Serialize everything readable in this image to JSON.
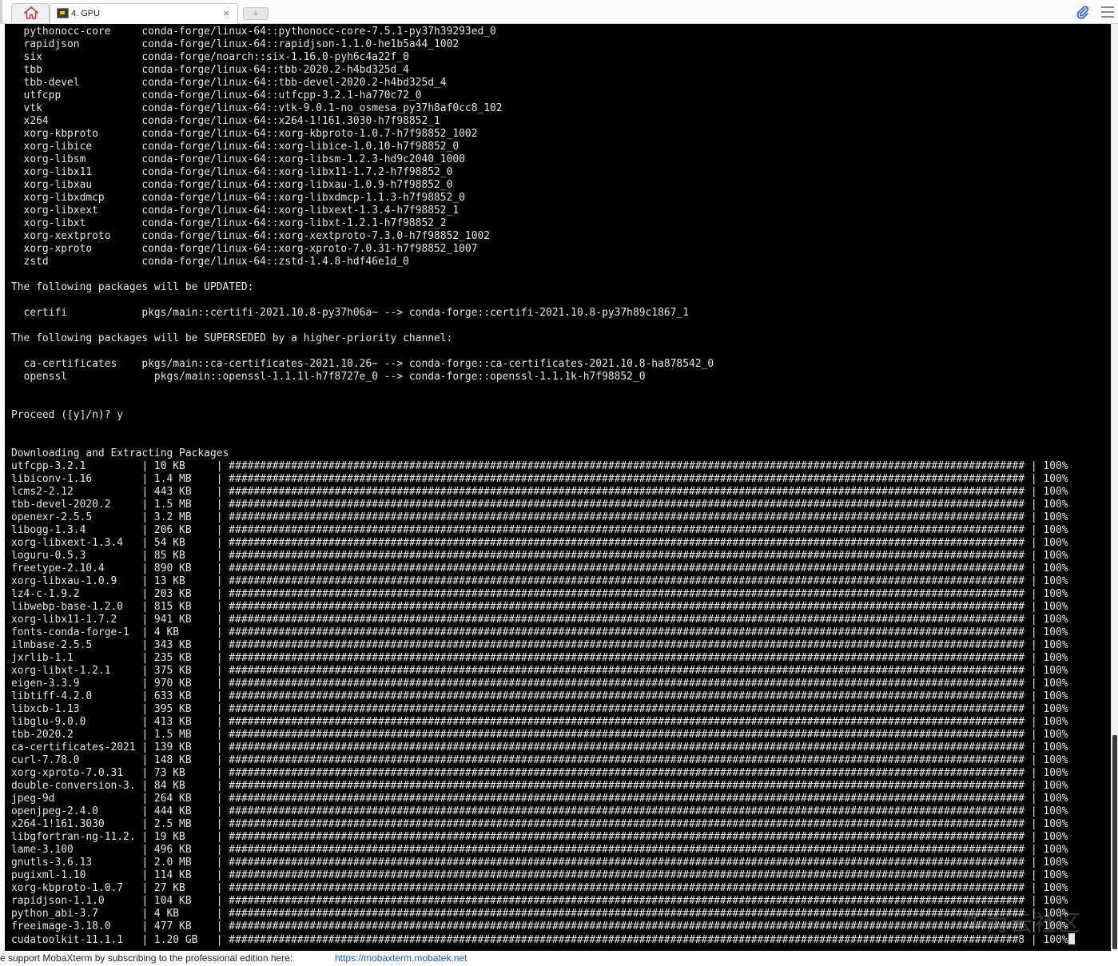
{
  "tabs": {
    "home_icon": "home-icon",
    "active_tab_label": "4. GPU",
    "close_glyph": "×",
    "new_tab_glyph": "+"
  },
  "toolbar": {
    "attach_icon": "paperclip-icon",
    "menu_icon": "hamburger-menu-icon"
  },
  "terminal": {
    "installed_packages": [
      {
        "name": "pythonocc-core",
        "spec": "conda-forge/linux-64::pythonocc-core-7.5.1-py37h39293ed_0"
      },
      {
        "name": "rapidjson",
        "spec": "conda-forge/linux-64::rapidjson-1.1.0-he1b5a44_1002"
      },
      {
        "name": "six",
        "spec": "conda-forge/noarch::six-1.16.0-pyh6c4a22f_0"
      },
      {
        "name": "tbb",
        "spec": "conda-forge/linux-64::tbb-2020.2-h4bd325d_4"
      },
      {
        "name": "tbb-devel",
        "spec": "conda-forge/linux-64::tbb-devel-2020.2-h4bd325d_4"
      },
      {
        "name": "utfcpp",
        "spec": "conda-forge/linux-64::utfcpp-3.2.1-ha770c72_0"
      },
      {
        "name": "vtk",
        "spec": "conda-forge/linux-64::vtk-9.0.1-no_osmesa_py37h8af0cc8_102"
      },
      {
        "name": "x264",
        "spec": "conda-forge/linux-64::x264-1!161.3030-h7f98852_1"
      },
      {
        "name": "xorg-kbproto",
        "spec": "conda-forge/linux-64::xorg-kbproto-1.0.7-h7f98852_1002"
      },
      {
        "name": "xorg-libice",
        "spec": "conda-forge/linux-64::xorg-libice-1.0.10-h7f98852_0"
      },
      {
        "name": "xorg-libsm",
        "spec": "conda-forge/linux-64::xorg-libsm-1.2.3-hd9c2040_1000"
      },
      {
        "name": "xorg-libx11",
        "spec": "conda-forge/linux-64::xorg-libx11-1.7.2-h7f98852_0"
      },
      {
        "name": "xorg-libxau",
        "spec": "conda-forge/linux-64::xorg-libxau-1.0.9-h7f98852_0"
      },
      {
        "name": "xorg-libxdmcp",
        "spec": "conda-forge/linux-64::xorg-libxdmcp-1.1.3-h7f98852_0"
      },
      {
        "name": "xorg-libxext",
        "spec": "conda-forge/linux-64::xorg-libxext-1.3.4-h7f98852_1"
      },
      {
        "name": "xorg-libxt",
        "spec": "conda-forge/linux-64::xorg-libxt-1.2.1-h7f98852_2"
      },
      {
        "name": "xorg-xextproto",
        "spec": "conda-forge/linux-64::xorg-xextproto-7.3.0-h7f98852_1002"
      },
      {
        "name": "xorg-xproto",
        "spec": "conda-forge/linux-64::xorg-xproto-7.0.31-h7f98852_1007"
      },
      {
        "name": "zstd",
        "spec": "conda-forge/linux-64::zstd-1.4.8-hdf46e1d_0"
      }
    ],
    "updated_heading": "The following packages will be UPDATED:",
    "updated_packages": [
      {
        "name": "certifi",
        "spec": "pkgs/main::certifi-2021.10.8-py37h06a~ --> conda-forge::certifi-2021.10.8-py37h89c1867_1"
      }
    ],
    "superseded_heading": "The following packages will be SUPERSEDED by a higher-priority channel:",
    "superseded_packages": [
      {
        "name": "ca-certificates",
        "spec": "pkgs/main::ca-certificates-2021.10.26~ --> conda-forge::ca-certificates-2021.10.8-ha878542_0"
      },
      {
        "name": "openssl",
        "spec": "  pkgs/main::openssl-1.1.1l-h7f8727e_0 --> conda-forge::openssl-1.1.1k-h7f98852_0"
      }
    ],
    "proceed_prompt": "Proceed ([y]/n)? y",
    "download_heading": "Downloading and Extracting Packages",
    "downloads": [
      {
        "pkg": "utfcpp-3.2.1",
        "size": "10 KB",
        "pct": "100%"
      },
      {
        "pkg": "libiconv-1.16",
        "size": "1.4 MB",
        "pct": "100%"
      },
      {
        "pkg": "lcms2-2.12",
        "size": "443 KB",
        "pct": "100%"
      },
      {
        "pkg": "tbb-devel-2020.2",
        "size": "1.5 MB",
        "pct": "100%"
      },
      {
        "pkg": "openexr-2.5.5",
        "size": "3.2 MB",
        "pct": "100%"
      },
      {
        "pkg": "libogg-1.3.4",
        "size": "206 KB",
        "pct": "100%"
      },
      {
        "pkg": "xorg-libxext-1.3.4",
        "size": "54 KB",
        "pct": "100%"
      },
      {
        "pkg": "loguru-0.5.3",
        "size": "85 KB",
        "pct": "100%"
      },
      {
        "pkg": "freetype-2.10.4",
        "size": "890 KB",
        "pct": "100%"
      },
      {
        "pkg": "xorg-libxau-1.0.9",
        "size": "13 KB",
        "pct": "100%"
      },
      {
        "pkg": "lz4-c-1.9.2",
        "size": "203 KB",
        "pct": "100%"
      },
      {
        "pkg": "libwebp-base-1.2.0",
        "size": "815 KB",
        "pct": "100%"
      },
      {
        "pkg": "xorg-libx11-1.7.2",
        "size": "941 KB",
        "pct": "100%"
      },
      {
        "pkg": "fonts-conda-forge-1",
        "size": "4 KB",
        "pct": "100%"
      },
      {
        "pkg": "ilmbase-2.5.5",
        "size": "343 KB",
        "pct": "100%"
      },
      {
        "pkg": "jxrlib-1.1",
        "size": "235 KB",
        "pct": "100%"
      },
      {
        "pkg": "xorg-libxt-1.2.1",
        "size": "375 KB",
        "pct": "100%"
      },
      {
        "pkg": "eigen-3.3.9",
        "size": "970 KB",
        "pct": "100%"
      },
      {
        "pkg": "libtiff-4.2.0",
        "size": "633 KB",
        "pct": "100%"
      },
      {
        "pkg": "libxcb-1.13",
        "size": "395 KB",
        "pct": "100%"
      },
      {
        "pkg": "libglu-9.0.0",
        "size": "413 KB",
        "pct": "100%"
      },
      {
        "pkg": "tbb-2020.2",
        "size": "1.5 MB",
        "pct": "100%"
      },
      {
        "pkg": "ca-certificates-2021",
        "size": "139 KB",
        "pct": "100%"
      },
      {
        "pkg": "curl-7.78.0",
        "size": "148 KB",
        "pct": "100%"
      },
      {
        "pkg": "xorg-xproto-7.0.31",
        "size": "73 KB",
        "pct": "100%"
      },
      {
        "pkg": "double-conversion-3.",
        "size": "84 KB",
        "pct": "100%"
      },
      {
        "pkg": "jpeg-9d",
        "size": "264 KB",
        "pct": "100%"
      },
      {
        "pkg": "openjpeg-2.4.0",
        "size": "444 KB",
        "pct": "100%"
      },
      {
        "pkg": "x264-1!161.3030",
        "size": "2.5 MB",
        "pct": "100%"
      },
      {
        "pkg": "libgfortran-ng-11.2.",
        "size": "19 KB",
        "pct": "100%"
      },
      {
        "pkg": "lame-3.100",
        "size": "496 KB",
        "pct": "100%"
      },
      {
        "pkg": "gnutls-3.6.13",
        "size": "2.0 MB",
        "pct": "100%"
      },
      {
        "pkg": "pugixml-1.10",
        "size": "114 KB",
        "pct": "100%"
      },
      {
        "pkg": "xorg-kbproto-1.0.7",
        "size": "27 KB",
        "pct": "100%"
      },
      {
        "pkg": "rapidjson-1.1.0",
        "size": "104 KB",
        "pct": "100%"
      },
      {
        "pkg": "python_abi-3.7",
        "size": "4 KB",
        "pct": "100%"
      },
      {
        "pkg": "freeimage-3.18.0",
        "size": "477 KB",
        "pct": "100%"
      },
      {
        "pkg": "cudatoolkit-11.1.1",
        "size": "1.20 GB",
        "pct": "100%",
        "bar_tail": "8"
      }
    ]
  },
  "watermark": "华为云社区",
  "footer": {
    "text": "e support MobaXterm by subscribing to the professional edition here:",
    "link": "https://mobaxterm.mobatek.net"
  }
}
